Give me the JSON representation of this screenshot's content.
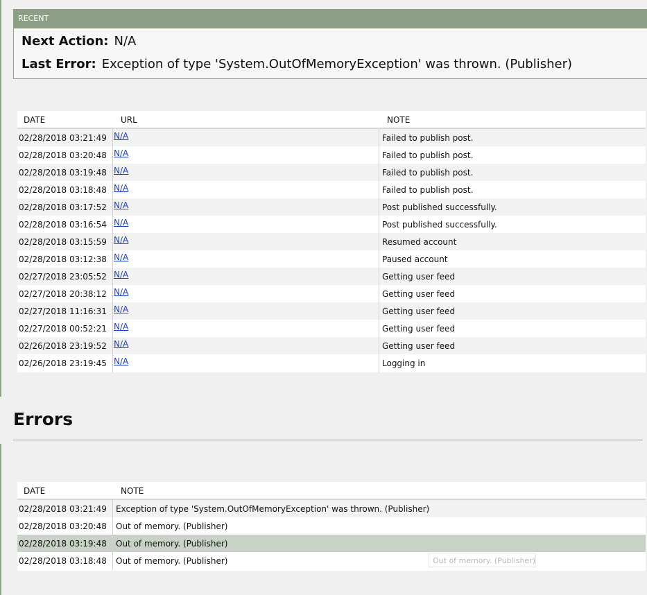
{
  "recent": {
    "header": "RECENT",
    "next_action_label": "Next Action:",
    "next_action_value": "N/A",
    "last_error_label": "Last Error:",
    "last_error_value": "Exception of type 'System.OutOfMemoryException' was thrown. (Publisher)"
  },
  "activity_table": {
    "columns": {
      "date": "DATE",
      "url": "URL",
      "note": "NOTE"
    },
    "rows": [
      {
        "date": "02/28/2018 03:21:49",
        "url": "N/A",
        "note": "Failed to publish post."
      },
      {
        "date": "02/28/2018 03:20:48",
        "url": "N/A",
        "note": "Failed to publish post."
      },
      {
        "date": "02/28/2018 03:19:48",
        "url": "N/A",
        "note": "Failed to publish post."
      },
      {
        "date": "02/28/2018 03:18:48",
        "url": "N/A",
        "note": "Failed to publish post."
      },
      {
        "date": "02/28/2018 03:17:52",
        "url": "N/A",
        "note": "Post published successfully."
      },
      {
        "date": "02/28/2018 03:16:54",
        "url": "N/A",
        "note": "Post published successfully."
      },
      {
        "date": "02/28/2018 03:15:59",
        "url": "N/A",
        "note": "Resumed account"
      },
      {
        "date": "02/28/2018 03:12:38",
        "url": "N/A",
        "note": "Paused account"
      },
      {
        "date": "02/27/2018 23:05:52",
        "url": "N/A",
        "note": "Getting user feed"
      },
      {
        "date": "02/27/2018 20:38:12",
        "url": "N/A",
        "note": "Getting user feed"
      },
      {
        "date": "02/27/2018 11:16:31",
        "url": "N/A",
        "note": "Getting user feed"
      },
      {
        "date": "02/27/2018 00:52:21",
        "url": "N/A",
        "note": "Getting user feed"
      },
      {
        "date": "02/26/2018 23:19:52",
        "url": "N/A",
        "note": "Getting user feed"
      },
      {
        "date": "02/26/2018 23:19:45",
        "url": "N/A",
        "note": "Logging in"
      }
    ]
  },
  "errors": {
    "title": "Errors",
    "columns": {
      "date": "DATE",
      "note": "NOTE"
    },
    "rows": [
      {
        "date": "02/28/2018 03:21:49",
        "note": "Exception of type 'System.OutOfMemoryException' was thrown. (Publisher)"
      },
      {
        "date": "02/28/2018 03:20:48",
        "note": "Out of memory. (Publisher)"
      },
      {
        "date": "02/28/2018 03:19:48",
        "note": "Out of memory. (Publisher)"
      },
      {
        "date": "02/28/2018 03:18:48",
        "note": "Out of memory. (Publisher)"
      }
    ],
    "selected_row_index": 2,
    "tooltip": "Out of memory. (Publisher)"
  },
  "colors": {
    "header_green": "#8c9f85",
    "selected_row": "#c8d2c6",
    "link_blue": "#1a3fd0"
  }
}
